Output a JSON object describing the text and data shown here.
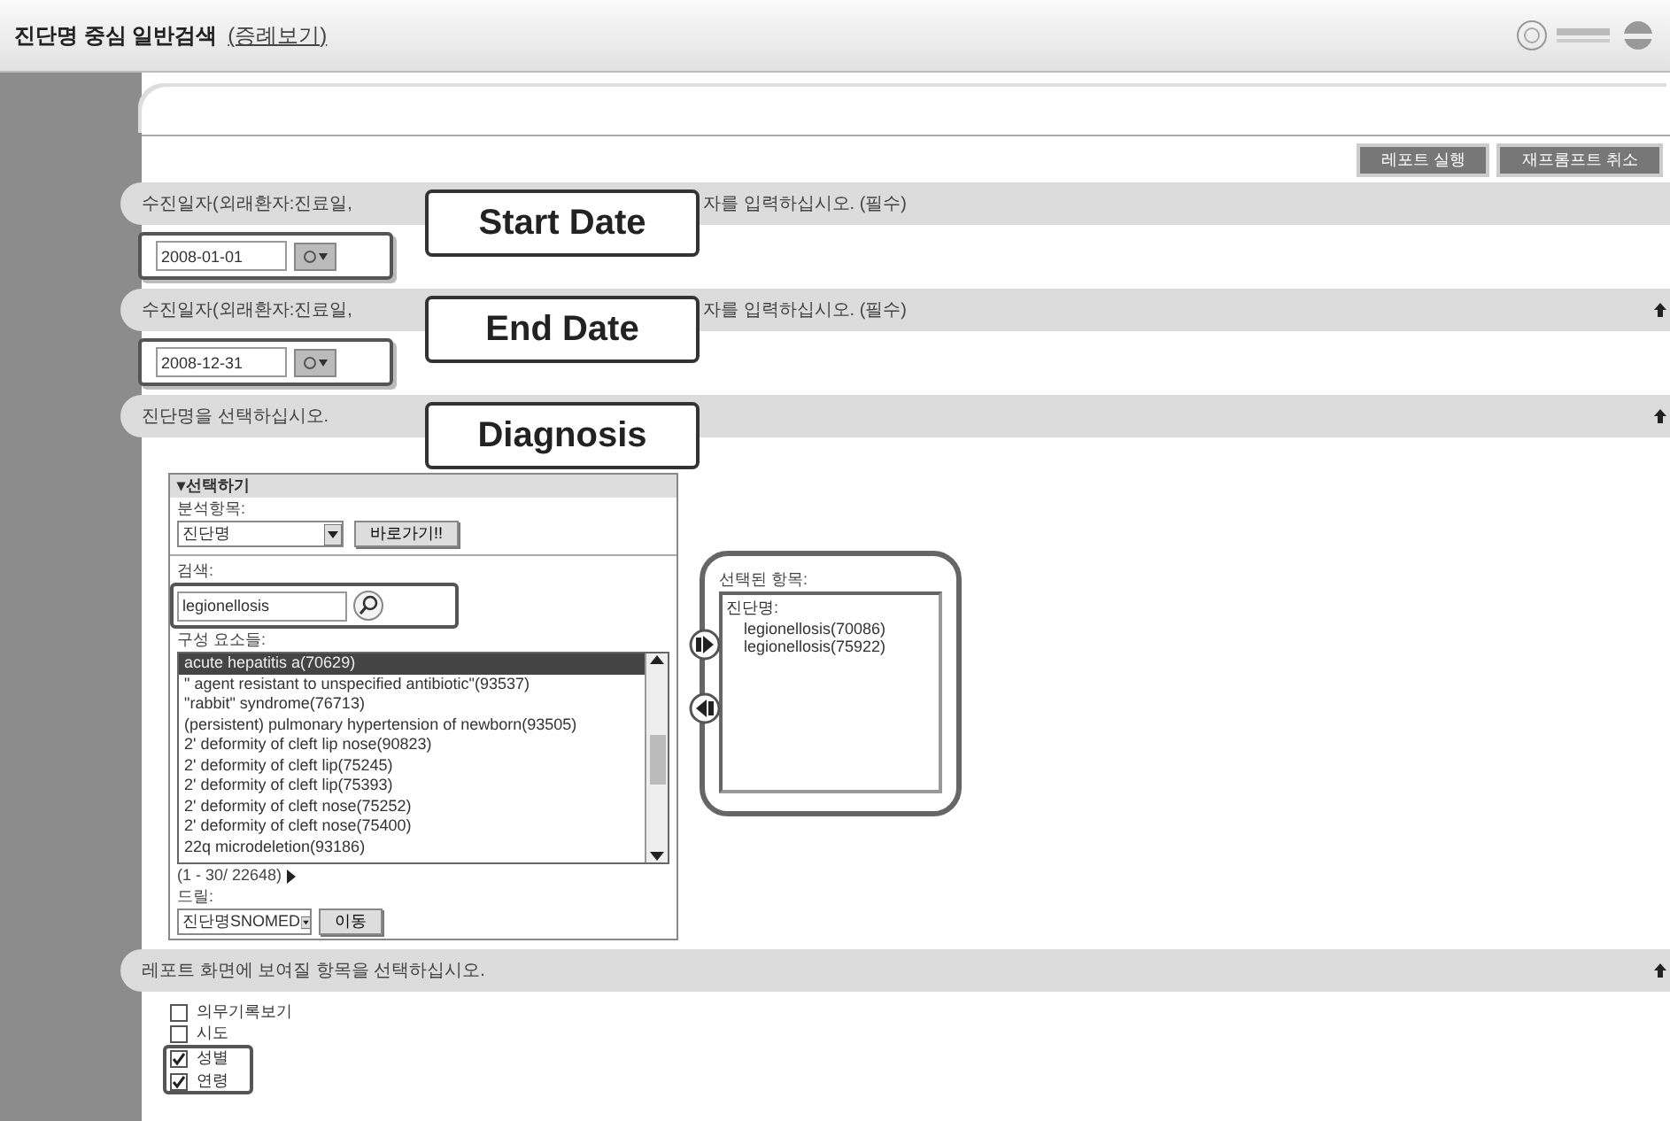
{
  "title_bar": {
    "title": "진단명 중심 일반검색",
    "link": "(증례보기)"
  },
  "toolbar": {
    "buttons": [
      "레포트 실행",
      "재프롬프트 취소"
    ]
  },
  "sections": [
    {
      "kind": "date",
      "header_left": "수진일자(외래환자:진료일,",
      "header_right": "자를 입력하십시오. (필수)",
      "top_icon": false,
      "value": "2008-01-01",
      "callout": "Start Date"
    },
    {
      "kind": "date",
      "header_left": "수진일자(외래환자:진료일,",
      "header_right": "자를 입력하십시오. (필수)",
      "top_icon": true,
      "value": "2008-12-31",
      "callout": "End Date"
    },
    {
      "kind": "diagnosis",
      "header_left": "진단명을 선택하십시오.",
      "top_icon": true,
      "callout": "Diagnosis"
    },
    {
      "kind": "checks",
      "header_left": "레포트 화면에 보여질 항목을 선택하십시오.",
      "top_icon": true
    }
  ],
  "picker": {
    "header": "▾선택하기",
    "analysis_label": "분석항목:",
    "analysis_value": "진단명",
    "go_button": "바로가기!!",
    "search_label": "검색:",
    "search_value": "legionellosis",
    "elements_label": "구성 요소들:",
    "elements": [
      {
        "label": "acute hepatitis a(70629)",
        "selected": true
      },
      {
        "label": "\" agent resistant to unspecified antibiotic\"(93537)",
        "selected": false
      },
      {
        "label": "\"rabbit\" syndrome(76713)",
        "selected": false
      },
      {
        "label": "(persistent) pulmonary hypertension of newborn(93505)",
        "selected": false
      },
      {
        "label": "2' deformity of cleft lip nose(90823)",
        "selected": false
      },
      {
        "label": "2' deformity of cleft lip(75245)",
        "selected": false
      },
      {
        "label": "2' deformity of cleft lip(75393)",
        "selected": false
      },
      {
        "label": "2' deformity of cleft nose(75252)",
        "selected": false
      },
      {
        "label": "2' deformity of cleft nose(75400)",
        "selected": false
      },
      {
        "label": "22q microdeletion(93186)",
        "selected": false
      }
    ],
    "paging": "(1 - 30/ 22648)",
    "drill_label": "드릴:",
    "drill_value": "진단명SNOMED",
    "move_button": "이동"
  },
  "selected_panel": {
    "label": "선택된 항목:",
    "tree": [
      {
        "label": "진단명:",
        "children": [
          {
            "label": "legionellosis(70086)"
          },
          {
            "label": "legionellosis(75922)"
          }
        ]
      }
    ]
  },
  "report_items": [
    {
      "label": "의무기록보기",
      "checked": false
    },
    {
      "label": "시도",
      "checked": false
    },
    {
      "label": "성별",
      "checked": true
    },
    {
      "label": "연령",
      "checked": true
    }
  ]
}
